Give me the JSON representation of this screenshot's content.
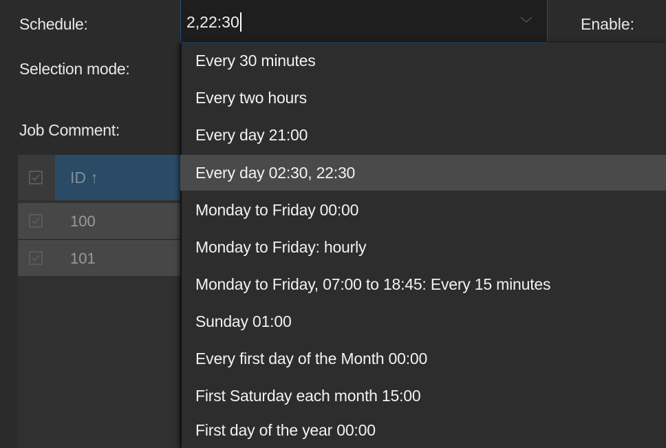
{
  "form": {
    "schedule_label": "Schedule:",
    "selection_mode_label": "Selection mode:",
    "job_comment_label": "Job Comment:",
    "enable_label": "Enable:"
  },
  "schedule": {
    "value": "2,22:30"
  },
  "table": {
    "columns": [
      {
        "label": "ID ↑"
      }
    ],
    "rows": [
      {
        "id": "100"
      },
      {
        "id": "101"
      }
    ]
  },
  "dropdown": {
    "selected_index": 3,
    "options": [
      "Every 30 minutes",
      "Every two hours",
      "Every day 21:00",
      "Every day 02:30, 22:30",
      "Monday to Friday 00:00",
      "Monday to Friday: hourly",
      "Monday to Friday, 07:00 to 18:45: Every 15 minutes",
      "Sunday 01:00",
      "Every first day of the Month 00:00",
      "First Saturday each month 15:00",
      "First day of the year 00:00"
    ]
  },
  "colors": {
    "background": "#2b2b2b",
    "dropdown_bg": "#2d2d2d",
    "selected_option_bg": "#4a4a4a",
    "input_border": "#1f4f79",
    "header_accent": "#2a4a66"
  },
  "icons": {
    "combo_chevron": "chevron-down-icon",
    "checkbox": "checkbox-checked-icon"
  }
}
